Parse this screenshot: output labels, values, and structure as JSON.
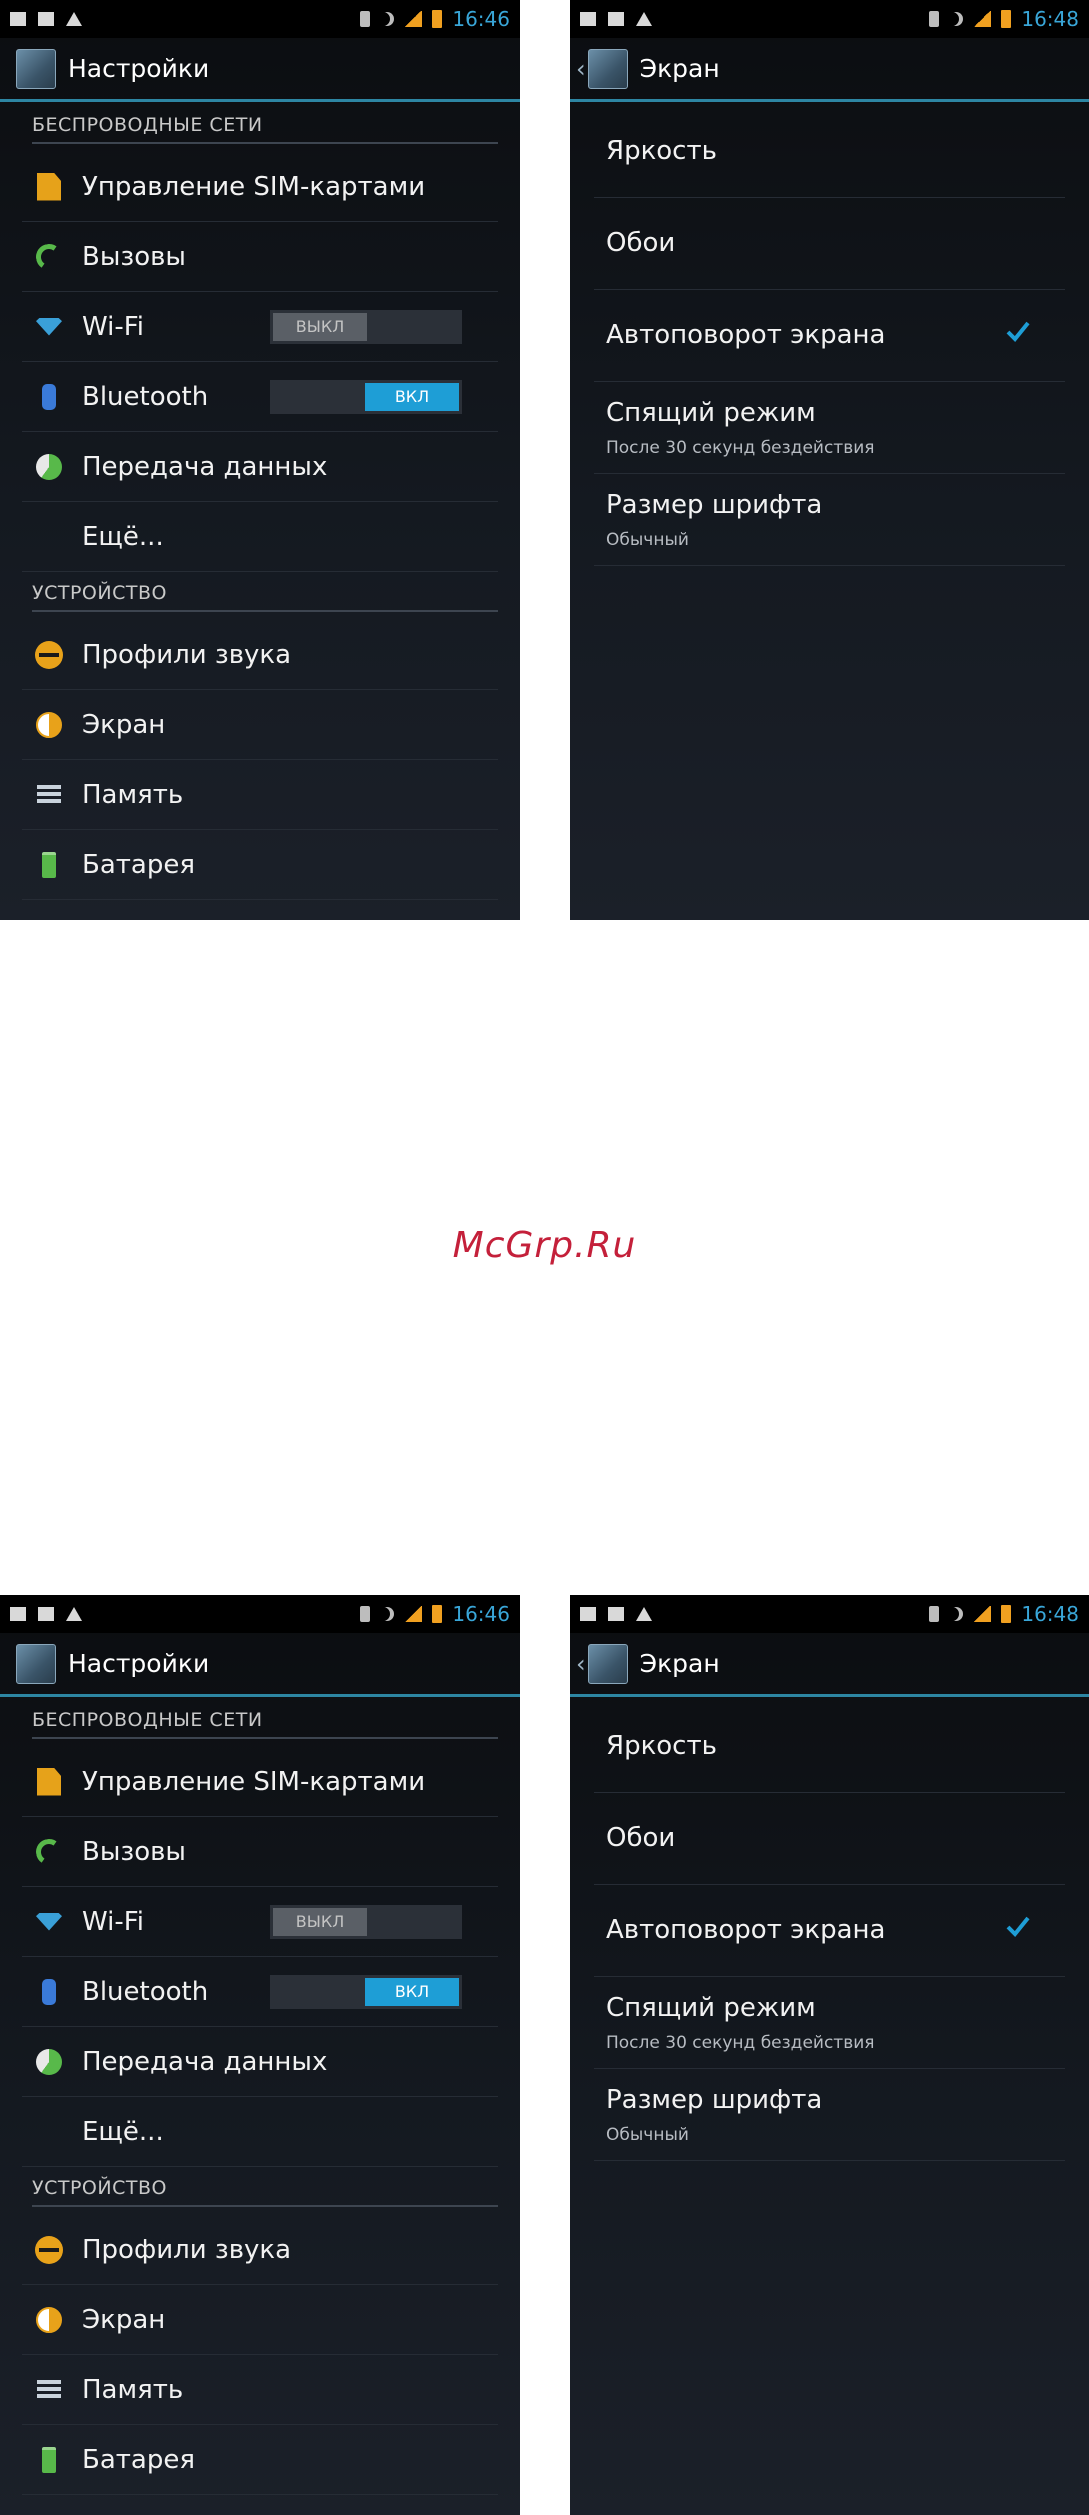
{
  "status_bar": {
    "time_settings": "16:46",
    "time_screen": "16:48",
    "icons_left": [
      "gallery-icon",
      "message-icon",
      "warning-icon"
    ],
    "icons_right": [
      "sim-status-icon",
      "night-mode-icon",
      "signal-icon",
      "battery-icon"
    ]
  },
  "settings": {
    "title": "Настройки",
    "wireless_header": "БЕСПРОВОДНЫЕ СЕТИ",
    "device_header": "УСТРОЙСТВО",
    "items": {
      "sim": "Управление SIM-картами",
      "calls": "Вызовы",
      "wifi": "Wi-Fi",
      "bluetooth": "Bluetooth",
      "data": "Передача данных",
      "more": "Ещё...",
      "sound": "Профили звука",
      "screen": "Экран",
      "memory": "Память",
      "battery": "Батарея"
    },
    "wifi_toggle": "ВЫКЛ",
    "bluetooth_toggle": "ВКЛ",
    "colors": {
      "accent": "#1e9ed6",
      "divider": "#2d86a3"
    }
  },
  "screen": {
    "title": "Экран",
    "brightness": "Яркость",
    "wallpaper": "Обои",
    "autorotate": "Автоповорот экрана",
    "autorotate_checked": true,
    "sleep": "Спящий режим",
    "sleep_value": "После 30 секунд бездействия",
    "font_size": "Размер шрифта",
    "font_size_value": "Обычный"
  },
  "watermark": "McGrp.Ru"
}
